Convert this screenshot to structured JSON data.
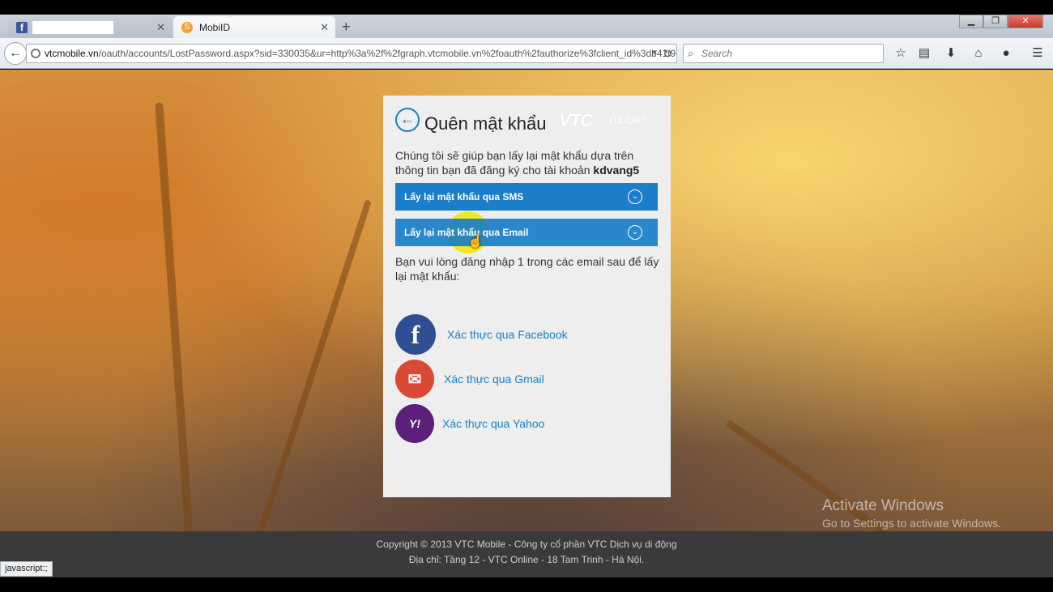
{
  "browser": {
    "tabs": [
      {
        "title": "",
        "icon": "facebook-icon"
      },
      {
        "title": "MobiID",
        "icon": "mobiid-icon"
      }
    ],
    "new_tab": "+",
    "url": {
      "domain": "vtcmobile.vn",
      "path": "/oauth/accounts/LostPassword.aspx?sid=330035&ur=http%3a%2f%2fgraph.vtcmobile.vn%2foauth%2fauthorize%3fclient_id%3db41f9"
    },
    "search_placeholder": "Search",
    "status_text": "javascript:;"
  },
  "card": {
    "title": "Quên mật khẩu",
    "logo": {
      "main": "VTC",
      "sub": "mobile",
      "tag": "for dufu"
    },
    "intro": "Chúng tôi sẽ giúp bạn lấy lại mật khẩu dựa trên thông tin bạn đã đăng ký cho tài khoản",
    "account": "kdvang5",
    "options": [
      {
        "label": "Lấy lại mật khẩu qua SMS"
      },
      {
        "label": "Lấy lại mật khẩu qua Email"
      }
    ],
    "note": "Bạn vui lòng đăng nhập 1 trong các email sau để lấy lại mật khẩu:",
    "social": [
      {
        "label": "Xác thực qua Facebook",
        "icon": "facebook-icon",
        "color": "#2e4f91"
      },
      {
        "label": "Xác thực qua Gmail",
        "icon": "mail-icon",
        "color": "#d84a34"
      },
      {
        "label": "Xác thực qua Yahoo",
        "icon": "yahoo-icon",
        "color": "#5c1f7a"
      }
    ]
  },
  "watermark": {
    "line1": "Activate Windows",
    "line2": "Go to Settings to activate Windows."
  },
  "footer": {
    "line1": "Copyright © 2013 VTC Mobile - Công ty cổ phần VTC Dịch vụ di động",
    "line2": "Địa chỉ: Tầng 12 - VTC Online - 18 Tam Trinh - Hà Nội."
  },
  "colors": {
    "accent": "#1a7ec8",
    "card_bg": "#eeeeee",
    "footer_bg": "#3a3a3a"
  }
}
